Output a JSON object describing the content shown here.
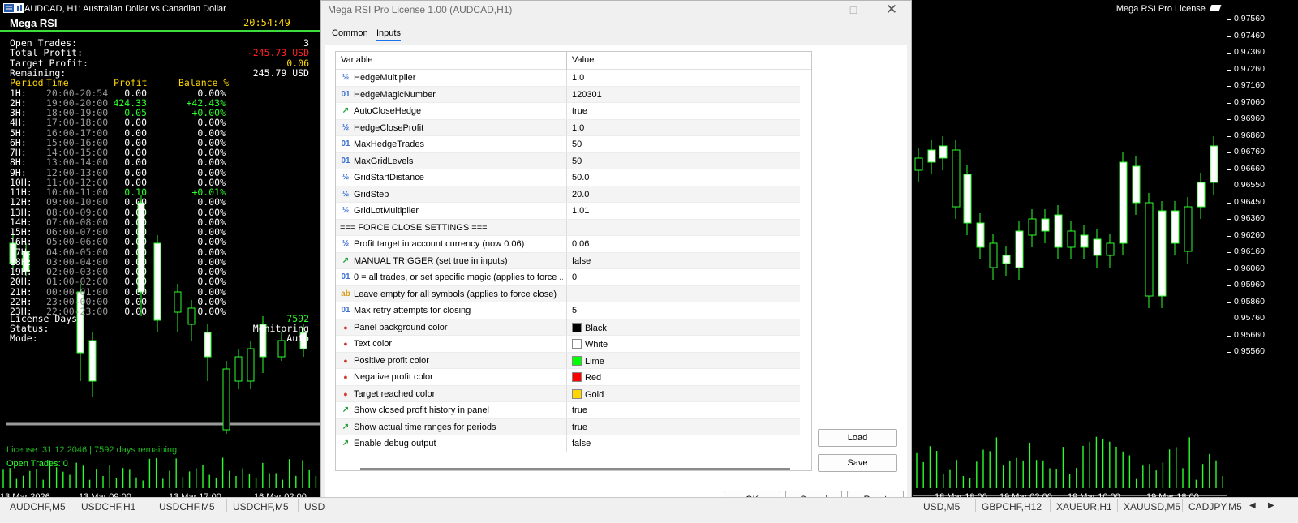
{
  "window": {
    "chart_title": "AUDCAD, H1:  Australian Dollar vs Canadian Dollar",
    "chart_brand": "Mega RSI Pro License",
    "brand_icon": "graduation-cap-icon"
  },
  "panel": {
    "title": "Mega RSI",
    "clock": "20:54:49",
    "summary": [
      {
        "label": "Open Trades:",
        "value": "3",
        "color": "#ffffff"
      },
      {
        "label": "Total Profit:",
        "value": "-245.73 USD",
        "color": "#ff2020"
      },
      {
        "label": "Target Profit:",
        "value": "0.06",
        "color": "#ffd700"
      },
      {
        "label": "Remaining:",
        "value": "245.79 USD",
        "color": "#ffffff"
      }
    ],
    "headers": {
      "period": "Period",
      "time": "Time",
      "profit": "Profit",
      "balance": "Balance %"
    },
    "periods": [
      {
        "p": "1H:",
        "t": "20:00-20:54",
        "profit": "0.00",
        "bal": "0.00%",
        "pos": false
      },
      {
        "p": "2H:",
        "t": "19:00-20:00",
        "profit": "424.33",
        "bal": "+42.43%",
        "pos": true
      },
      {
        "p": "3H:",
        "t": "18:00-19:00",
        "profit": "0.05",
        "bal": "+0.00%",
        "pos": true
      },
      {
        "p": "4H:",
        "t": "17:00-18:00",
        "profit": "0.00",
        "bal": "0.00%",
        "pos": false
      },
      {
        "p": "5H:",
        "t": "16:00-17:00",
        "profit": "0.00",
        "bal": "0.00%",
        "pos": false
      },
      {
        "p": "6H:",
        "t": "15:00-16:00",
        "profit": "0.00",
        "bal": "0.00%",
        "pos": false
      },
      {
        "p": "7H:",
        "t": "14:00-15:00",
        "profit": "0.00",
        "bal": "0.00%",
        "pos": false
      },
      {
        "p": "8H:",
        "t": "13:00-14:00",
        "profit": "0.00",
        "bal": "0.00%",
        "pos": false
      },
      {
        "p": "9H:",
        "t": "12:00-13:00",
        "profit": "0.00",
        "bal": "0.00%",
        "pos": false
      },
      {
        "p": "10H:",
        "t": "11:00-12:00",
        "profit": "0.00",
        "bal": "0.00%",
        "pos": false
      },
      {
        "p": "11H:",
        "t": "10:00-11:00",
        "profit": "0.10",
        "bal": "+0.01%",
        "pos": true
      },
      {
        "p": "12H:",
        "t": "09:00-10:00",
        "profit": "0.00",
        "bal": "0.00%",
        "pos": false
      },
      {
        "p": "13H:",
        "t": "08:00-09:00",
        "profit": "0.00",
        "bal": "0.00%",
        "pos": false
      },
      {
        "p": "14H:",
        "t": "07:00-08:00",
        "profit": "0.00",
        "bal": "0.00%",
        "pos": false
      },
      {
        "p": "15H:",
        "t": "06:00-07:00",
        "profit": "0.00",
        "bal": "0.00%",
        "pos": false
      },
      {
        "p": "16H:",
        "t": "05:00-06:00",
        "profit": "0.00",
        "bal": "0.00%",
        "pos": false
      },
      {
        "p": "17H:",
        "t": "04:00-05:00",
        "profit": "0.00",
        "bal": "0.00%",
        "pos": false
      },
      {
        "p": "18H:",
        "t": "03:00-04:00",
        "profit": "0.00",
        "bal": "0.00%",
        "pos": false
      },
      {
        "p": "19H:",
        "t": "02:00-03:00",
        "profit": "0.00",
        "bal": "0.00%",
        "pos": false
      },
      {
        "p": "20H:",
        "t": "01:00-02:00",
        "profit": "0.00",
        "bal": "0.00%",
        "pos": false
      },
      {
        "p": "21H:",
        "t": "00:00-01:00",
        "profit": "0.00",
        "bal": "0.00%",
        "pos": false
      },
      {
        "p": "22H:",
        "t": "23:00-00:00",
        "profit": "0.00",
        "bal": "0.00%",
        "pos": false
      },
      {
        "p": "23H:",
        "t": "22:00-23:00",
        "profit": "0.00",
        "bal": "0.00%",
        "pos": false
      }
    ],
    "license_days_label": "License Days:",
    "license_days_value": "7592",
    "status_label": "Status:",
    "status_value": "Monitoring",
    "mode_label": "Mode:",
    "mode_value": "Auto",
    "footer_license": "License: 31.12.2046 | 7592 days remaining",
    "footer_open_trades": "Open Trades: 0"
  },
  "y_axis": [
    "0.97560",
    "0.97460",
    "0.97360",
    "0.97260",
    "0.97160",
    "0.97060",
    "0.96960",
    "0.96860",
    "0.96760",
    "0.96660",
    "0.96550",
    "0.96450",
    "0.96360",
    "0.96260",
    "0.96160",
    "0.96060",
    "0.95960",
    "0.95860",
    "0.95760",
    "0.95660",
    "0.95560"
  ],
  "x_axis": [
    "13 Mar 2026",
    "13 Mar 09:00",
    "13 Mar 17:00",
    "16 Mar 02:00",
    "18 Mar 18:00",
    "19 Mar 02:00",
    "19 Mar 10:00",
    "19 Mar 18:00"
  ],
  "dialog": {
    "title": "Mega RSI Pro License 1.00 (AUDCAD,H1)",
    "tabs": [
      {
        "label": "Common",
        "active": false
      },
      {
        "label": "Inputs",
        "active": true
      }
    ],
    "col_variable": "Variable",
    "col_value": "Value",
    "rows": [
      {
        "icon": "half",
        "var": "HedgeMultiplier",
        "val": "1.0"
      },
      {
        "icon": "int",
        "var": "HedgeMagicNumber",
        "val": "120301"
      },
      {
        "icon": "bool",
        "var": "AutoCloseHedge",
        "val": "true"
      },
      {
        "icon": "half",
        "var": "HedgeCloseProfit",
        "val": "1.0"
      },
      {
        "icon": "int",
        "var": "MaxHedgeTrades",
        "val": "50"
      },
      {
        "icon": "int",
        "var": "MaxGridLevels",
        "val": "50"
      },
      {
        "icon": "half",
        "var": "GridStartDistance",
        "val": "50.0"
      },
      {
        "icon": "half",
        "var": "GridStep",
        "val": "20.0"
      },
      {
        "icon": "half",
        "var": "GridLotMultiplier",
        "val": "1.01"
      },
      {
        "icon": "none",
        "var": "=== FORCE CLOSE SETTINGS ===",
        "val": ""
      },
      {
        "icon": "half",
        "var": "Profit target in account currency (now 0.06)",
        "val": "0.06"
      },
      {
        "icon": "bool",
        "var": "MANUAL TRIGGER (set true in inputs)",
        "val": "false"
      },
      {
        "icon": "int",
        "var": "0 = all trades, or set specific magic (applies to force ...",
        "val": "0"
      },
      {
        "icon": "str",
        "var": "Leave empty for all symbols (applies to force close)",
        "val": ""
      },
      {
        "icon": "int",
        "var": "Max retry attempts for closing",
        "val": "5"
      },
      {
        "icon": "color",
        "var": "Panel background color",
        "val": "Black",
        "swatch": "#000000"
      },
      {
        "icon": "color",
        "var": "Text color",
        "val": "White",
        "swatch": "#ffffff"
      },
      {
        "icon": "color",
        "var": "Positive profit color",
        "val": "Lime",
        "swatch": "#00ff00"
      },
      {
        "icon": "color",
        "var": "Negative profit color",
        "val": "Red",
        "swatch": "#ff0000"
      },
      {
        "icon": "color",
        "var": "Target reached color",
        "val": "Gold",
        "swatch": "#ffd700"
      },
      {
        "icon": "bool",
        "var": "Show closed profit history in panel",
        "val": "true"
      },
      {
        "icon": "bool",
        "var": "Show actual time ranges for periods",
        "val": "true"
      },
      {
        "icon": "bool",
        "var": "Enable debug output",
        "val": "false"
      }
    ],
    "buttons": {
      "load": "Load",
      "save": "Save",
      "ok": "OK",
      "cancel": "Cancel",
      "reset": "Reset"
    }
  },
  "symbol_tabs": [
    "AUDCHF,M5",
    "USDCHF,H1",
    "USDCHF,M5",
    "USDCHF,M5",
    "USD",
    "USD,M5",
    "GBPCHF,H12",
    "XAUEUR,H1",
    "XAUUSD,M5",
    "CADJPY,M5"
  ],
  "colors": {
    "bull": "#ffffff",
    "line": "#2bff2b",
    "positive": "#2bff2b",
    "negative": "#ff2020",
    "target": "#ffd700"
  }
}
